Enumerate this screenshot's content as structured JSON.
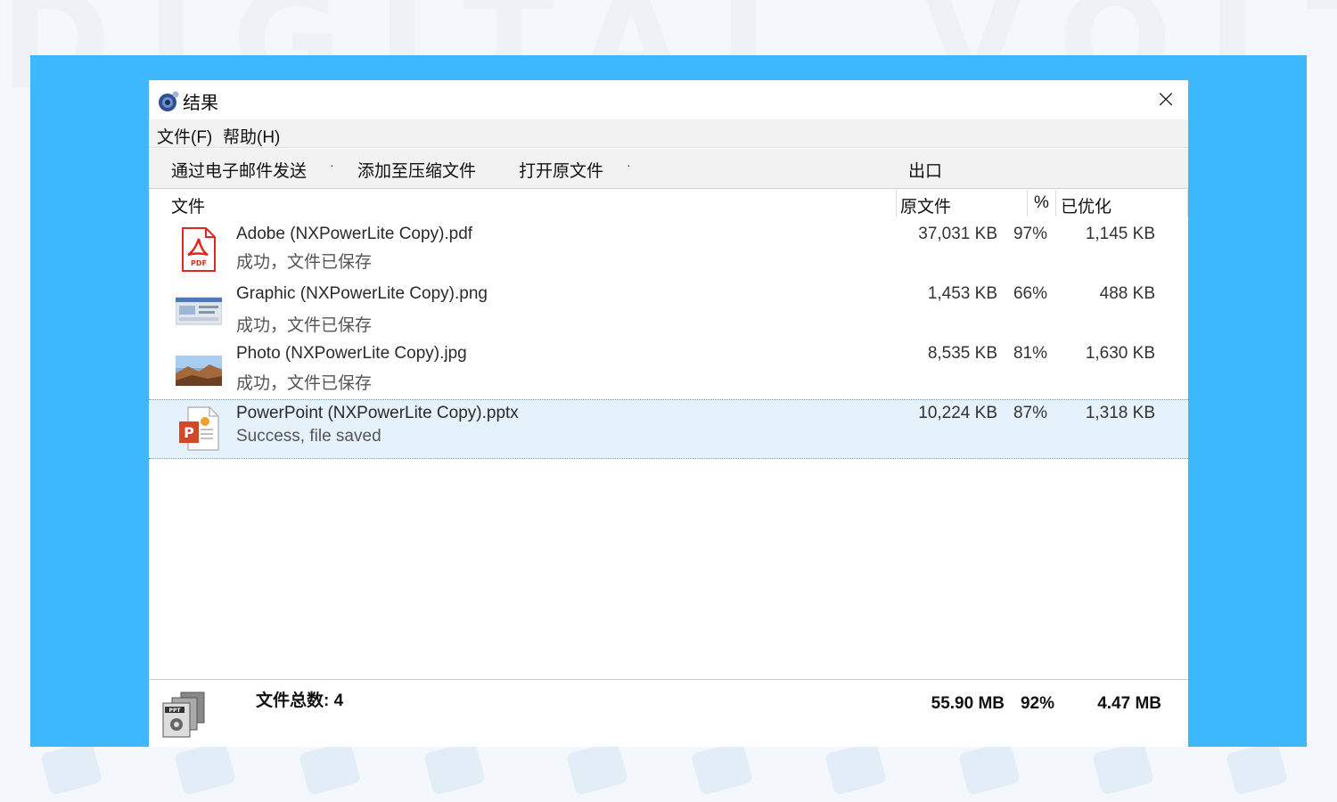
{
  "background_text": "DIGITAL VOLTE",
  "window": {
    "title": "结果",
    "close_glyph": "×"
  },
  "menu": {
    "file": "文件(F)",
    "help": "帮助(H)"
  },
  "toolbar": {
    "email": "通过电子邮件发送",
    "dropdown_glyph": "·",
    "zip": "添加至压缩文件",
    "open_original": "打开原文件",
    "export": "出口"
  },
  "columns": {
    "file": "文件",
    "original": "原文件",
    "percent": "%",
    "optimized": "已优化"
  },
  "files": [
    {
      "icon": "pdf-file-icon",
      "name": "Adobe (NXPowerLite Copy).pdf",
      "status": "成功，文件已保存",
      "original": "37,031 KB",
      "percent": "97%",
      "optimized": "1,145 KB",
      "selected": false
    },
    {
      "icon": "png-file-icon",
      "name": "Graphic (NXPowerLite Copy).png",
      "status": "成功，文件已保存",
      "original": "1,453 KB",
      "percent": "66%",
      "optimized": "488 KB",
      "selected": false
    },
    {
      "icon": "jpg-file-icon",
      "name": "Photo (NXPowerLite Copy).jpg",
      "status": "成功，文件已保存",
      "original": "8,535 KB",
      "percent": "81%",
      "optimized": "1,630 KB",
      "selected": false
    },
    {
      "icon": "pptx-file-icon",
      "name": "PowerPoint (NXPowerLite Copy).pptx",
      "status": "Success, file saved",
      "original": "10,224 KB",
      "percent": "87%",
      "optimized": "1,318 KB",
      "selected": true
    }
  ],
  "footer": {
    "total_label": "文件总数: 4",
    "total_original": "55.90 MB",
    "total_percent": "92%",
    "total_optimized": "4.47 MB"
  },
  "colors": {
    "frame_blue": "#3db8fd",
    "selection": "#e5f1fb",
    "pdf_red": "#e0271f",
    "ppt_orange": "#d24726"
  }
}
